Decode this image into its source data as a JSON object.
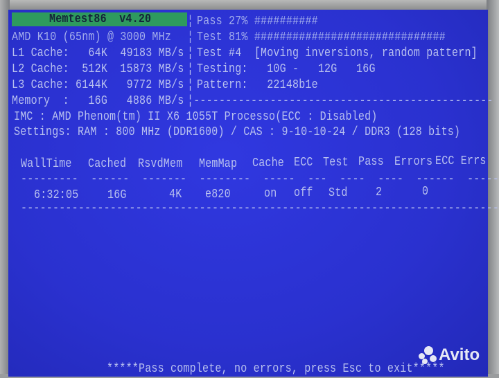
{
  "header": {
    "title": "Memtest86  v4.20"
  },
  "system": [
    "AMD K10 (65nm) @ 3000 MHz",
    "L1 Cache:   64K  49183 MB/s",
    "L2 Cache:  512K  15873 MB/s",
    "L3 Cache: 6144K   9772 MB/s",
    "Memory  :   16G   4886 MB/s"
  ],
  "progress": {
    "pass_label": "Pass 27%",
    "pass_bar": "##########",
    "pass_percent": 27,
    "test_label": "Test 81%",
    "test_bar": "##############################",
    "test_percent": 81,
    "test_name": "Test #4  [Moving inversions, random pattern]",
    "testing": "Testing:   10G -   12G   16G",
    "pattern": "Pattern:   22148b1e"
  },
  "imc": "IMC : AMD Phenom(tm) II X6 1055T Processo(ECC : Disabled)",
  "settings": "Settings: RAM : 800 MHz (DDR1600) / CAS : 9-10-10-24 / DDR3 (128 bits)",
  "table": {
    "columns": [
      "WallTime",
      "Cached",
      "RsvdMem",
      "MemMap",
      "Cache",
      "ECC",
      "Test",
      "Pass",
      "Errors",
      "ECC Errs"
    ],
    "rows": [
      [
        "6:32:05",
        "16G",
        "4K",
        "e820",
        "on",
        "off",
        "Std",
        "2",
        "0",
        ""
      ]
    ]
  },
  "footer": "*****Pass complete, no errors, press Esc to exit*****",
  "watermark": "Avito",
  "colors": {
    "screen": "#2b33d6",
    "title_bar": "#2e9a5e",
    "text": "#b8c0ef"
  }
}
